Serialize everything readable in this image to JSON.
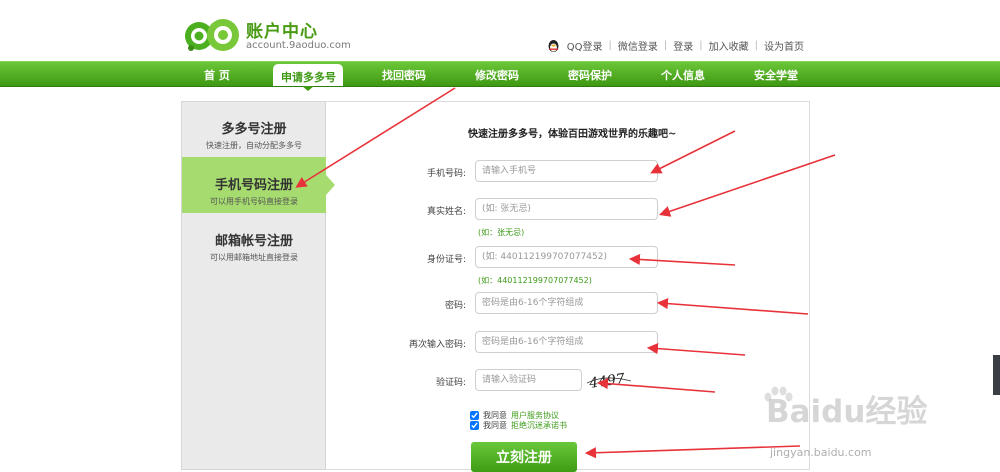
{
  "header": {
    "logo_text": "账户中心",
    "domain": "account.9aoduo.com",
    "top_links": [
      "QQ登录",
      "微信登录",
      "登录",
      "加入收藏",
      "设为首页"
    ]
  },
  "nav": {
    "items": [
      "首 页",
      "申请多多号",
      "找回密码",
      "修改密码",
      "密码保护",
      "个人信息",
      "安全学堂"
    ],
    "active": "申请多多号"
  },
  "sidebar": {
    "items": [
      {
        "title": "多多号注册",
        "subtitle": "快速注册，自动分配多多号"
      },
      {
        "title": "手机号码注册",
        "subtitle": "可以用手机号码直接登录"
      },
      {
        "title": "邮箱帐号注册",
        "subtitle": "可以用邮箱地址直接登录"
      }
    ],
    "active_index": 1
  },
  "form": {
    "title": "快速注册多多号，体验百田游戏世界的乐趣吧~",
    "phone": {
      "label": "手机号码:",
      "placeholder": "请输入手机号"
    },
    "name": {
      "label": "真实姓名:",
      "placeholder": "(如: 张无忌)",
      "hint": "(如：张无忌)"
    },
    "idcard": {
      "label": "身份证号:",
      "placeholder": "(如: 440112199707077452)",
      "hint": "(如：440112199707077452)"
    },
    "password": {
      "label": "密码:",
      "placeholder": "密码是由6-16个字符组成"
    },
    "password2": {
      "label": "再次输入密码:",
      "placeholder": "密码是由6-16个字符组成"
    },
    "captcha": {
      "label": "验证码:",
      "placeholder": "请输入验证码",
      "image_text": "4497"
    },
    "agree1": {
      "label": "我同意",
      "link": "用户服务协议"
    },
    "agree2": {
      "label": "我同意",
      "link": "拒绝沉迷承诺书"
    },
    "submit": "立刻注册"
  },
  "watermark": {
    "brand": "Baidu经验",
    "url": "jingyan.baidu.com"
  },
  "colors": {
    "brand_green": "#4a9a14",
    "nav_green": "#52ae22",
    "side_active": "#a6dc6f",
    "arrow_red": "#e8323a"
  }
}
